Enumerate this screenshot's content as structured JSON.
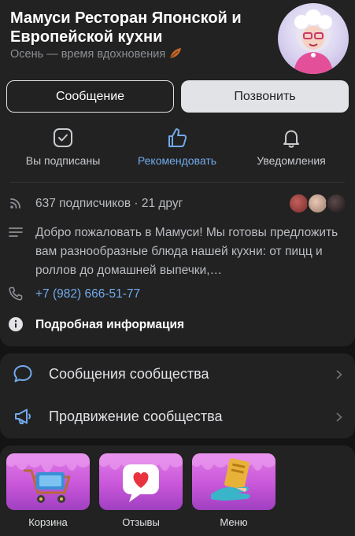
{
  "header": {
    "title": "Мамуси Ресторан Японской и Европейской кухни",
    "status": "Осень — время вдохновения",
    "status_icon": "autumn-leaf-icon"
  },
  "buttons": {
    "message": "Сообщение",
    "call": "Позвонить"
  },
  "actions": [
    {
      "label": "Вы подписаны",
      "icon": "checkbox-icon",
      "active": false
    },
    {
      "label": "Рекомендовать",
      "icon": "thumbs-up-icon",
      "active": true
    },
    {
      "label": "Уведомления",
      "icon": "bell-icon",
      "active": false
    }
  ],
  "info": {
    "subscribers": "637 подписчиков · 21 друг",
    "description": "Добро пожаловать в Мамуси! Мы готовы предложить вам разнообразные блюда нашей кухни: от пицц и роллов до домашней выпечки,…",
    "phone": "+7 (982) 666-51-77",
    "more": "Подробная информация"
  },
  "links": [
    {
      "label": "Сообщения сообщества",
      "icon": "chat-bubble-icon"
    },
    {
      "label": "Продвижение сообщества",
      "icon": "megaphone-icon"
    }
  ],
  "shop": [
    {
      "label": "Корзина",
      "icon": "shopping-cart-icon"
    },
    {
      "label": "Отзывы",
      "icon": "heart-message-icon"
    },
    {
      "label": "Меню",
      "icon": "menu-book-icon"
    }
  ],
  "colors": {
    "background": "#141414",
    "card": "#222222",
    "accent": "#71aaeb",
    "tile": "#c957d9"
  }
}
